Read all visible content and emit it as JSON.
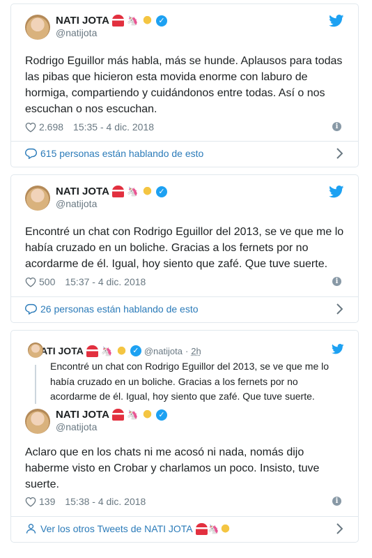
{
  "tweets": [
    {
      "author": {
        "name": "NATI JOTA",
        "handle": "@natijota",
        "emojis": [
          "circus-tent",
          "unicorn",
          "woman-tipping-hand"
        ]
      },
      "text": "Rodrigo Eguillor más habla, más se hunde. Aplausos para todas las pibas que hicieron esta movida enorme con laburo de hormiga, compartiendo y cuidándonos entre todas. Así o nos escuchan o nos escuchan.",
      "likes": "2.698",
      "timestamp": "15:35 - 4 dic. 2018",
      "footer": "615 personas están hablando de esto"
    },
    {
      "author": {
        "name": "NATI JOTA",
        "handle": "@natijota",
        "emojis": [
          "circus-tent",
          "unicorn",
          "woman-tipping-hand"
        ]
      },
      "text": "Encontré un chat con Rodrigo Eguillor del 2013, se ve que me lo había cruzado en un boliche. Gracias a los fernets por no acordarme de él. Igual, hoy siento que zafé. Que tuve suerte.",
      "likes": "500",
      "timestamp": "15:37 - 4 dic. 2018",
      "footer": "26 personas están hablando de esto"
    },
    {
      "quoted": {
        "name": "NATI JOTA",
        "handle": "@natijota",
        "separator": "·",
        "time": "2h",
        "text": "Encontré un chat con Rodrigo Eguillor del 2013, se ve que me lo había cruzado en un boliche. Gracias a los fernets por no acordarme de él. Igual, hoy siento que zafé. Que tuve suerte."
      },
      "author": {
        "name": "NATI JOTA",
        "handle": "@natijota",
        "emojis": [
          "circus-tent",
          "unicorn",
          "woman-tipping-hand"
        ]
      },
      "text": "Aclaro que en los chats ni me acosó ni nada, nomás dijo haberme visto en Crobar y charlamos un poco. Insisto, tuve suerte.",
      "likes": "139",
      "timestamp": "15:38 - 4 dic. 2018",
      "footer": "Ver los otros Tweets de NATI JOTA"
    }
  ],
  "colors": {
    "link": "#2b7bb9",
    "twitter_blue": "#1da1f2",
    "muted": "#697882",
    "border": "#e1e8ed"
  },
  "icons": {
    "logo": "twitter-bird-icon",
    "like": "heart-icon",
    "info": "info-icon",
    "reply": "speech-bubble-icon",
    "profile": "person-icon",
    "more": "chevron-right-icon",
    "verified": "verified-badge-icon"
  }
}
